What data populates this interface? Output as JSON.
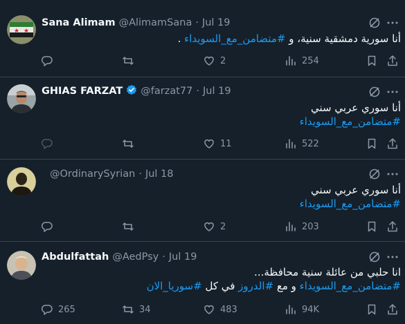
{
  "tweets": [
    {
      "name": "Sana Alimam",
      "handle": "@AlimamSana",
      "time": "Jul 19",
      "verified": false,
      "lines": [
        [
          {
            "t": "أنا سورية دمشقية سنية، و ",
            "h": false
          },
          {
            "t": "#متضامن_مع_السويداء",
            "h": true
          },
          {
            "t": " .",
            "h": false
          }
        ]
      ],
      "replies": "",
      "retweets": "",
      "likes": "2",
      "views": "254",
      "reply_disabled": false
    },
    {
      "name": "GHIAS FARZAT",
      "handle": "@farzat77",
      "time": "Jul 19",
      "verified": true,
      "lines": [
        [
          {
            "t": "أنا سوري عربي سني",
            "h": false
          }
        ],
        [
          {
            "t": "#متضامن_مع_السويداء",
            "h": true
          }
        ]
      ],
      "replies": "",
      "retweets": "",
      "likes": "11",
      "views": "522",
      "reply_disabled": true
    },
    {
      "name": "",
      "handle": "@OrdinarySyrian",
      "time": "Jul 18",
      "verified": false,
      "lines": [
        [
          {
            "t": "أنا سوري عربي سني",
            "h": false
          }
        ],
        [
          {
            "t": "#متضامن_مع_السويداء",
            "h": true
          }
        ]
      ],
      "replies": "",
      "retweets": "",
      "likes": "2",
      "views": "203",
      "reply_disabled": false
    },
    {
      "name": "Abdulfattah",
      "handle": "@AedPsy",
      "time": "Jul 19",
      "verified": false,
      "lines": [
        [
          {
            "t": "انا حلبي من عائلة سنية محافظة...",
            "h": false
          }
        ],
        [
          {
            "t": "#متضامن_مع_السويداء",
            "h": true
          },
          {
            "t": " و مع ",
            "h": false
          },
          {
            "t": "#الدروز",
            "h": true
          },
          {
            "t": " في كل ",
            "h": false
          },
          {
            "t": "#سوريا_الان",
            "h": true
          }
        ]
      ],
      "replies": "265",
      "retweets": "34",
      "likes": "483",
      "views": "94K",
      "reply_disabled": false
    }
  ],
  "colors": {
    "background": "#15202b",
    "divider": "#38444d",
    "text": "#f7f9f9",
    "muted": "#8b98a5",
    "accent": "#1d9bf0"
  },
  "icons": {
    "reply": "speech-bubble-icon",
    "retweet": "retweet-arrows-icon",
    "like": "heart-icon",
    "views": "bar-chart-icon",
    "bookmark": "bookmark-icon",
    "share": "share-upload-icon",
    "grok": "grok-slash-circle-icon",
    "more": "more-dots-icon"
  }
}
